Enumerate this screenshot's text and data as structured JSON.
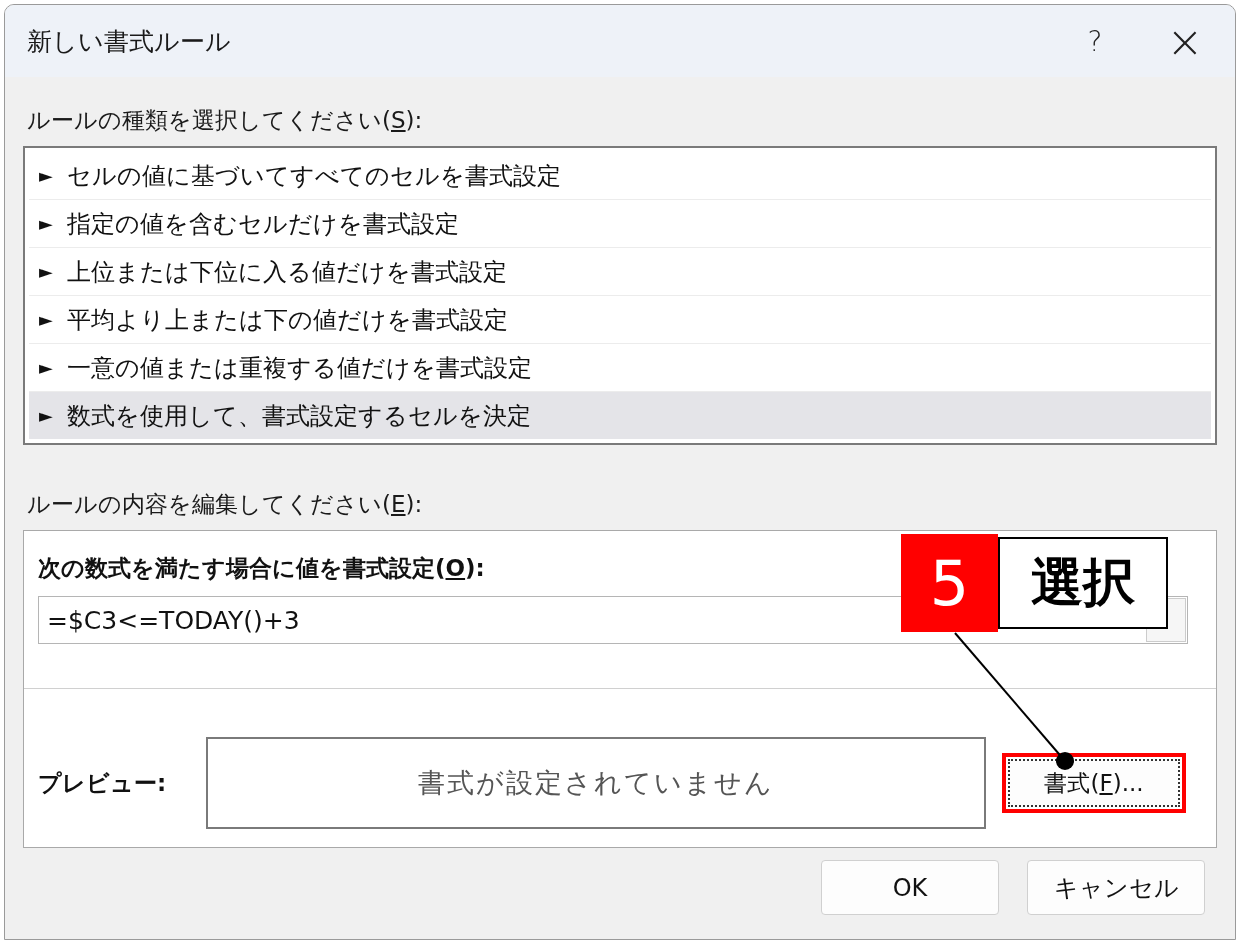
{
  "window": {
    "title": "新しい書式ルール",
    "help": "?",
    "close": "×"
  },
  "rule_type": {
    "label": {
      "before": "ルールの種類を選択してください(",
      "key": "S",
      "after": "):"
    },
    "items": [
      {
        "marker": "►",
        "text": "セルの値に基づいてすべてのセルを書式設定",
        "selected": false
      },
      {
        "marker": "►",
        "text": "指定の値を含むセルだけを書式設定",
        "selected": false
      },
      {
        "marker": "►",
        "text": "上位または下位に入る値だけを書式設定",
        "selected": false
      },
      {
        "marker": "►",
        "text": "平均より上または下の値だけを書式設定",
        "selected": false
      },
      {
        "marker": "►",
        "text": "一意の値または重複する値だけを書式設定",
        "selected": false
      },
      {
        "marker": "►",
        "text": "数式を使用して、書式設定するセルを決定",
        "selected": true
      }
    ]
  },
  "rule_edit": {
    "label": {
      "before": "ルールの内容を編集してください(",
      "key": "E",
      "after": "):"
    },
    "formula_label": {
      "before": "次の数式を満たす場合に値を書式設定(",
      "key": "O",
      "after": "):"
    },
    "formula_value": "=$C3<=TODAY()+3",
    "preview_label": "プレビュー:",
    "preview_text": "書式が設定されていません",
    "format_button": {
      "before": "書式(",
      "key": "F",
      "after": ")..."
    }
  },
  "buttons": [
    {
      "label": "OK"
    },
    {
      "label": "キャンセル"
    }
  ],
  "callout": {
    "number": "5",
    "text": "選択"
  }
}
